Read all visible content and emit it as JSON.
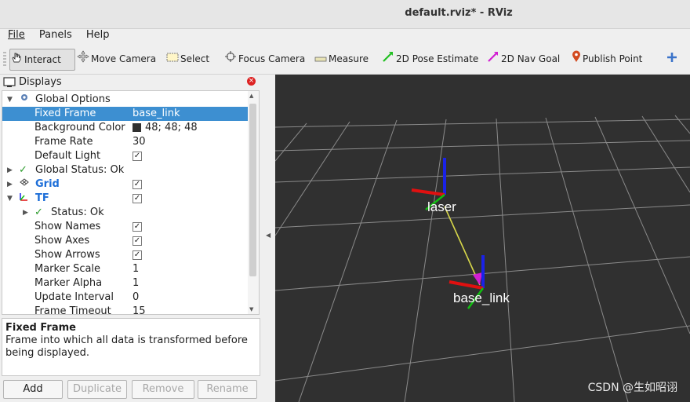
{
  "window": {
    "title": "default.rviz* - RViz"
  },
  "menu": [
    {
      "label": "File"
    },
    {
      "label": "Panels"
    },
    {
      "label": "Help"
    }
  ],
  "toolbar": {
    "interact": "Interact",
    "move_camera": "Move Camera",
    "select": "Select",
    "focus_camera": "Focus Camera",
    "measure": "Measure",
    "pose_estimate": "2D Pose Estimate",
    "nav_goal": "2D Nav Goal",
    "publish_point": "Publish Point",
    "add_tool_icon": "plus-icon"
  },
  "displays_panel": {
    "title": "Displays",
    "rows": [
      {
        "key": "Global Options",
        "value": ""
      },
      {
        "key": "Fixed Frame",
        "value": "base_link"
      },
      {
        "key": "Background Color",
        "value": "48; 48; 48"
      },
      {
        "key": "Frame Rate",
        "value": "30"
      },
      {
        "key": "Default Light",
        "value": ""
      },
      {
        "key": "Global Status: Ok",
        "value": ""
      },
      {
        "key": "Grid",
        "value": ""
      },
      {
        "key": "TF",
        "value": ""
      },
      {
        "key": "Status: Ok",
        "value": ""
      },
      {
        "key": "Show Names",
        "value": ""
      },
      {
        "key": "Show Axes",
        "value": ""
      },
      {
        "key": "Show Arrows",
        "value": ""
      },
      {
        "key": "Marker Scale",
        "value": "1"
      },
      {
        "key": "Marker Alpha",
        "value": "1"
      },
      {
        "key": "Update Interval",
        "value": "0"
      },
      {
        "key": "Frame Timeout",
        "value": "15"
      }
    ],
    "checks": {
      "default_light": "✓",
      "grid": "✓",
      "tf": "✓",
      "show_names": "✓",
      "show_axes": "✓",
      "show_arrows": "✓",
      "global_status": "✓",
      "tf_status": "✓"
    },
    "description": {
      "title": "Fixed Frame",
      "body": "Frame into which all data is transformed before being displayed."
    },
    "buttons": {
      "add": "Add",
      "duplicate": "Duplicate",
      "remove": "Remove",
      "rename": "Rename"
    }
  },
  "viewport": {
    "background": "#303030",
    "frames": [
      {
        "name": "laser"
      },
      {
        "name": "base_link"
      }
    ]
  },
  "watermark": "CSDN @生如昭诩",
  "colors": {
    "selection": "#3d8fd1",
    "x_axis": "#e01010",
    "y_axis": "#10c010",
    "z_axis": "#1a22e8",
    "tf_arrow": "#d6d64a"
  }
}
